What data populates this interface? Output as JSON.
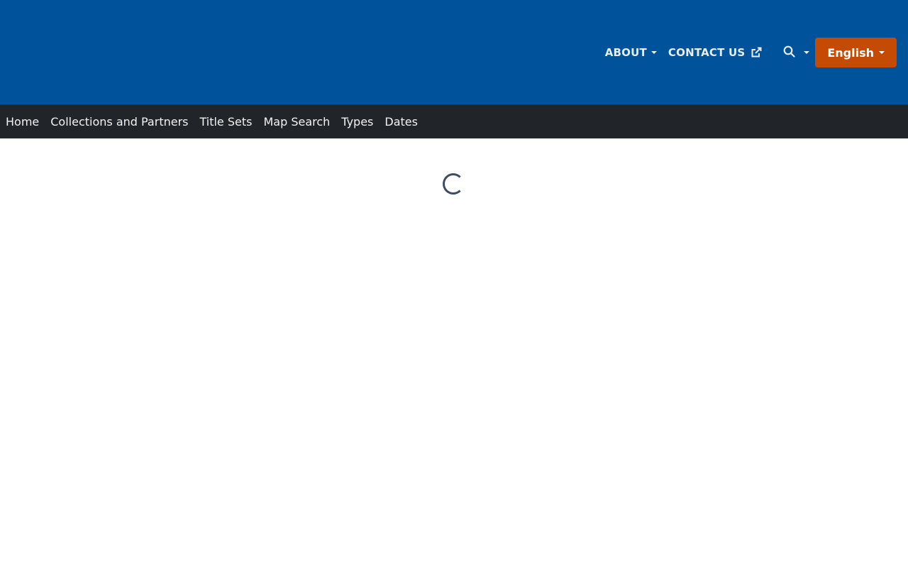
{
  "header": {
    "background_color": "#00529b",
    "nav": {
      "about_label": "ABOUT",
      "contact_label": "CONTACT US",
      "search_icon": "search-icon",
      "external_icon": "external-link-icon"
    },
    "language": {
      "selected": "English",
      "button_color": "#c54b05"
    }
  },
  "subnav": {
    "background_color": "#212529",
    "items": [
      {
        "label": "Home"
      },
      {
        "label": "Collections and Partners"
      },
      {
        "label": "Title Sets"
      },
      {
        "label": "Map Search"
      },
      {
        "label": "Types"
      },
      {
        "label": "Dates"
      }
    ]
  },
  "main": {
    "loading_indicator": "spinner-icon"
  }
}
